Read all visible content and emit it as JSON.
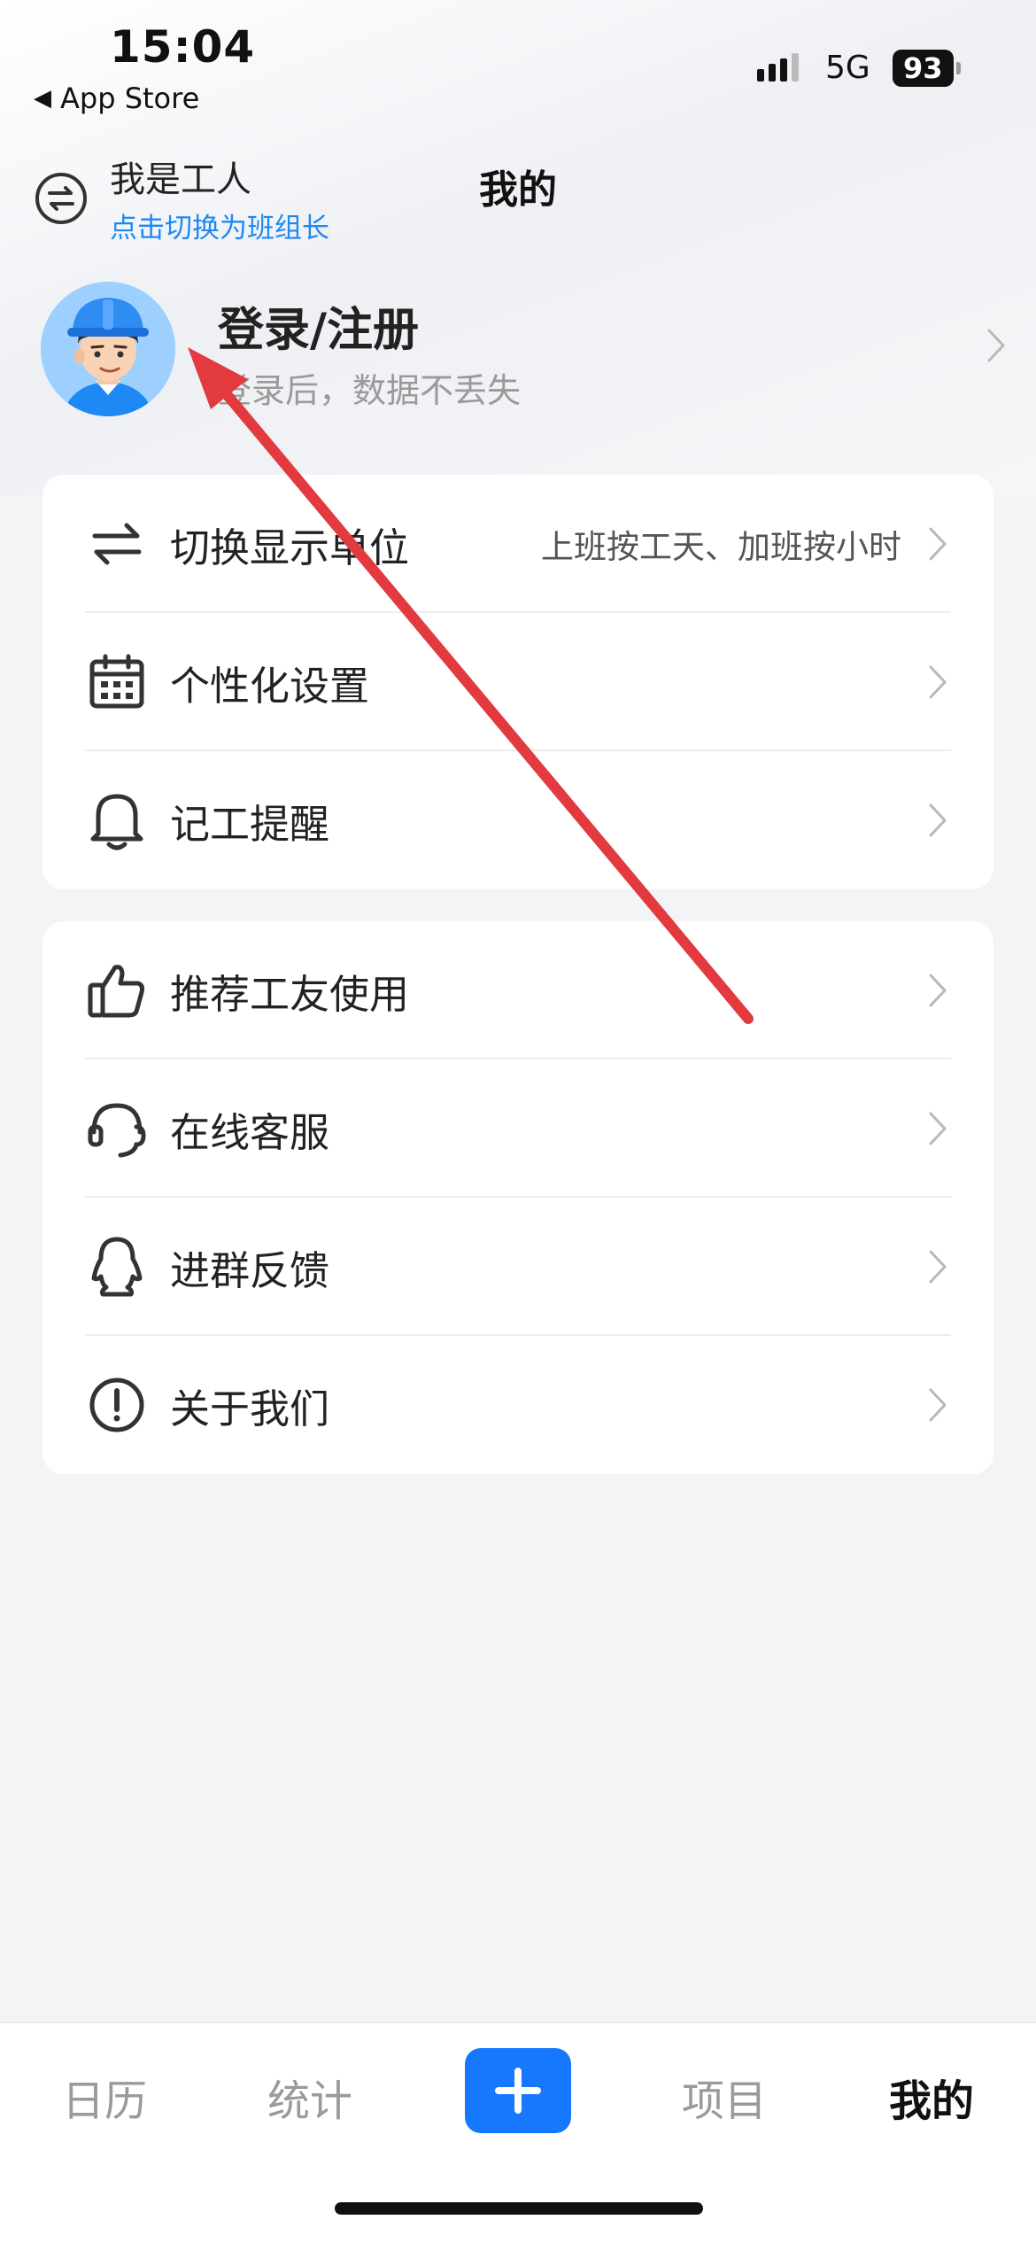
{
  "status_bar": {
    "time": "15:04",
    "back_app": "App Store",
    "network": "5G",
    "battery": "93",
    "signal_bars_filled": 3
  },
  "header": {
    "role_name": "我是工人",
    "role_hint": "点击切换为班组长",
    "title": "我的"
  },
  "profile": {
    "title": "登录/注册",
    "subtitle": "登录后，数据不丢失"
  },
  "settings_card": {
    "items": [
      {
        "label": "切换显示单位",
        "value": "上班按工天、加班按小时",
        "icon": "swap-arrows-icon"
      },
      {
        "label": "个性化设置",
        "value": "",
        "icon": "calendar-icon"
      },
      {
        "label": "记工提醒",
        "value": "",
        "icon": "bell-icon"
      }
    ]
  },
  "support_card": {
    "items": [
      {
        "label": "推荐工友使用",
        "icon": "thumbs-up-icon"
      },
      {
        "label": "在线客服",
        "icon": "headset-icon"
      },
      {
        "label": "进群反馈",
        "icon": "qq-penguin-icon"
      },
      {
        "label": "关于我们",
        "icon": "info-exclamation-icon"
      }
    ]
  },
  "tabbar": {
    "tabs": [
      "日历",
      "统计",
      "项目",
      "我的"
    ],
    "active": "我的"
  },
  "colors": {
    "accent": "#1677ff",
    "hint_blue": "#1e88f5",
    "annotation_arrow": "#e23a3f"
  }
}
